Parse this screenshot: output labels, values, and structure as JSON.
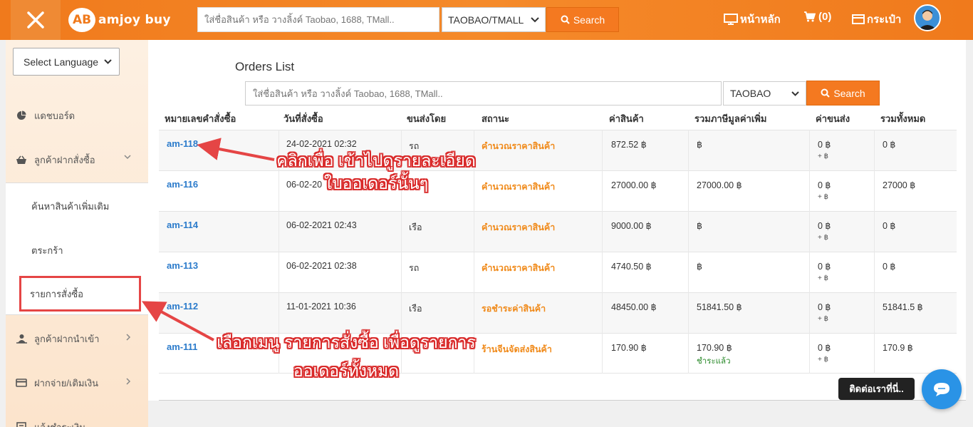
{
  "header": {
    "logo_badge": "AB",
    "logo_text": "amjoy buy",
    "search_placeholder": "ใส่ชื่อสินค้า หรือ วางลิ้งค์ Taobao, 1688, TMall..",
    "platform_selected": "TAOBAO/TMALL",
    "search_label": "Search",
    "home_label": "หน้าหลัก",
    "cart_label": "(0)",
    "wallet_label": "กระเป๋า"
  },
  "sidebar": {
    "language_selected": "Select Language",
    "items": [
      {
        "label": "แดชบอร์ด"
      },
      {
        "label": "ลูกค้าฝากสั่งซื้อ"
      },
      {
        "label": "ลูกค้าฝากนำเข้า"
      },
      {
        "label": "ฝากจ่าย/เติมเงิน"
      },
      {
        "label": "แจ้งชำระเงิน"
      }
    ],
    "sub_items": [
      {
        "label": "ค้นหาสินค้าเพิ่มเติม"
      },
      {
        "label": "ตระกร้า"
      },
      {
        "label": "รายการสั่งซื้อ"
      }
    ]
  },
  "main": {
    "title": "Orders List",
    "search_placeholder": "ใส่ชื่อสินค้า หรือ วางลิ้งค์ Taobao, 1688, TMall..",
    "platform_selected": "TAOBAO",
    "search_label": "Search",
    "columns": [
      "หมายเลขคำสั่งซื้อ",
      "วันที่สั่งซื้อ",
      "ขนส่งโดย",
      "สถานะ",
      "ค่าสินค้า",
      "รวมภาษีมูลค่าเพิ่ม",
      "ค่าขนส่ง",
      "รวมทั้งหมด"
    ],
    "rows": [
      {
        "id": "am-118",
        "date": "24-02-2021 02:32",
        "shipping": "รถ",
        "status": "คำนวณราคาสินค้า",
        "price": "872.52 ฿",
        "vat": "฿",
        "vat_note": "",
        "ship_fee": "0 ฿",
        "ship_extra": "+ ฿",
        "total": "0 ฿"
      },
      {
        "id": "am-116",
        "date": "06-02-20",
        "shipping": "",
        "status": "คำนวณราคาสินค้า",
        "price": "27000.00 ฿",
        "vat": "27000.00 ฿",
        "vat_note": "",
        "ship_fee": "0 ฿",
        "ship_extra": "+ ฿",
        "total": "27000 ฿"
      },
      {
        "id": "am-114",
        "date": "06-02-2021 02:43",
        "shipping": "เรือ",
        "status": "คำนวณราคาสินค้า",
        "price": "9000.00 ฿",
        "vat": "฿",
        "vat_note": "",
        "ship_fee": "0 ฿",
        "ship_extra": "+ ฿",
        "total": "0 ฿"
      },
      {
        "id": "am-113",
        "date": "06-02-2021 02:38",
        "shipping": "รถ",
        "status": "คำนวณราคาสินค้า",
        "price": "4740.50 ฿",
        "vat": "฿",
        "vat_note": "",
        "ship_fee": "0 ฿",
        "ship_extra": "+ ฿",
        "total": "0 ฿"
      },
      {
        "id": "am-112",
        "date": "11-01-2021 10:36",
        "shipping": "เรือ",
        "status": "รอชำระค่าสินค้า",
        "price": "48450.00 ฿",
        "vat": "51841.50 ฿",
        "vat_note": "",
        "ship_fee": "0 ฿",
        "ship_extra": "+ ฿",
        "total": "51841.5 ฿"
      },
      {
        "id": "am-111",
        "date": "",
        "shipping": "",
        "status": "ร้านจีนจัดส่งสินค้า",
        "price": "170.90 ฿",
        "vat": "170.90 ฿",
        "vat_note": "ชำระแล้ว",
        "ship_fee": "0 ฿",
        "ship_extra": "+ ฿",
        "total": "170.9 ฿"
      }
    ]
  },
  "annotations": {
    "top_line1": "คลิกเพื่อ เข้าไปดูรายละเอียด",
    "top_line2": "ใบออเดอร์นั้นๆ",
    "bottom_line1": "เลือกเมนู รายการสั่งซื้อ เพื่อดูรายการ",
    "bottom_line2": "ออเดอร์ทั้งหมด",
    "color": "#d92a2a"
  },
  "contact_label": "ติดต่อเราที่นี่..",
  "icons": [
    "close-icon",
    "search-icon",
    "monitor-icon",
    "cart-icon",
    "wallet-icon",
    "user-avatar",
    "chevron-down-icon",
    "chevron-right-icon",
    "dashboard-icon",
    "basket-icon",
    "import-icon",
    "card-icon",
    "chat-icon"
  ],
  "colors": {
    "brand_orange": "#f47920",
    "link_blue": "#2b7bcb",
    "status_orange": "#f08a1a",
    "paid_green": "#2a8a2a"
  }
}
